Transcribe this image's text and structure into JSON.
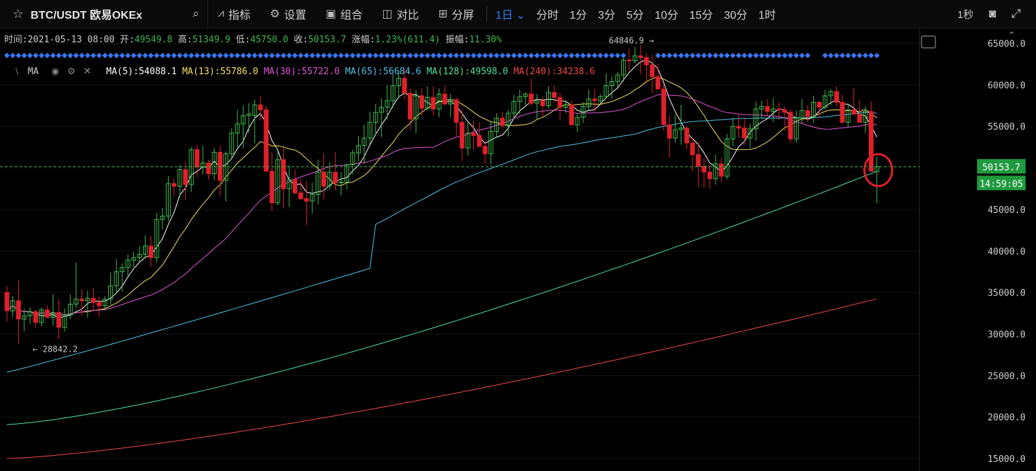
{
  "toolbar": {
    "symbol": "BTC/USDT 欧易OKEx",
    "indicators": "指标",
    "settings": "设置",
    "group": "组合",
    "compare": "对比",
    "split": "分屏",
    "intervals": [
      "1日",
      "分时",
      "1分",
      "3分",
      "5分",
      "10分",
      "15分",
      "30分",
      "1时"
    ],
    "active_interval": "1日",
    "refresh": "1秒"
  },
  "ohlc_bar": {
    "time_label": "时间:",
    "time": "2021-05-13 08:00",
    "open_label": "开:",
    "open": "49549.8",
    "high_label": "高:",
    "high": "51349.9",
    "low_label": "低:",
    "low": "45750.0",
    "close_label": "收:",
    "close": "50153.7",
    "change_label": "涨幅:",
    "change": "1.23%(611.4)",
    "amplitude_label": "振幅:",
    "amplitude": "11.30%"
  },
  "ma_bar": {
    "label": "MA",
    "items": [
      {
        "text": "MA(5):54088.1",
        "color": "#ffffff"
      },
      {
        "text": "MA(13):55786.0",
        "color": "#f5e15c"
      },
      {
        "text": "MA(30):55722.0",
        "color": "#e058d8"
      },
      {
        "text": "MA(65):56684.6",
        "color": "#4fc3e8"
      },
      {
        "text": "MA(128):49598.0",
        "color": "#4fe0a0"
      },
      {
        "text": "MA(240):34238.6",
        "color": "#f04848"
      }
    ]
  },
  "colors": {
    "up": "#3fb84f",
    "down": "#e0202a",
    "marker": "#3a78f2",
    "price_tag": "#1f9a3e"
  },
  "chart_data": {
    "type": "candlestick",
    "symbol": "BTC/USDT",
    "interval": "1日",
    "ylim": [
      13500,
      66800
    ],
    "yticks": [
      15000,
      20000,
      25000,
      30000,
      35000,
      40000,
      45000,
      50000,
      55000,
      60000,
      65000
    ],
    "ytick_labels": [
      "15000.0",
      "20000.0",
      "25000.0",
      "30000.0",
      "35000.0",
      "40000.0",
      "45000.0",
      "50000.0",
      "55000.0",
      "60000.0",
      "65000.0"
    ],
    "last_price": 50153.7,
    "last_price_label": "50153.7",
    "countdown": "14:59:05",
    "high_annotation": {
      "index": 112,
      "value": 64846.9,
      "label": "64846.9 →"
    },
    "low_annotation": {
      "index": 3,
      "value": 28842.2,
      "label": "← 28842.2"
    },
    "candles": [
      [
        35000,
        35800,
        31500,
        32800
      ],
      [
        32800,
        34600,
        32000,
        34000
      ],
      [
        34000,
        36500,
        28842.2,
        31800
      ],
      [
        31800,
        33000,
        30300,
        32200
      ],
      [
        32200,
        33200,
        31200,
        32700
      ],
      [
        32700,
        32900,
        30800,
        31400
      ],
      [
        31400,
        33200,
        30900,
        32900
      ],
      [
        32900,
        33500,
        31900,
        32000
      ],
      [
        32000,
        34800,
        31000,
        32600
      ],
      [
        32600,
        34200,
        29400,
        30800
      ],
      [
        30800,
        33100,
        30300,
        32300
      ],
      [
        32300,
        34800,
        31800,
        33600
      ],
      [
        33600,
        38600,
        33100,
        34200
      ],
      [
        34200,
        35400,
        32200,
        34000
      ],
      [
        34000,
        35200,
        32000,
        34300
      ],
      [
        34300,
        35500,
        32900,
        33800
      ],
      [
        33800,
        34500,
        32100,
        33400
      ],
      [
        33400,
        34600,
        32800,
        34200
      ],
      [
        34200,
        37400,
        33500,
        35800
      ],
      [
        35800,
        39000,
        34900,
        37500
      ],
      [
        37500,
        38500,
        35100,
        38000
      ],
      [
        38000,
        39600,
        37000,
        38900
      ],
      [
        38900,
        39900,
        38100,
        39200
      ],
      [
        39200,
        40600,
        38500,
        39600
      ],
      [
        39600,
        41900,
        39100,
        40600
      ],
      [
        40600,
        41800,
        38100,
        39200
      ],
      [
        39200,
        44600,
        38600,
        43800
      ],
      [
        43800,
        45200,
        42600,
        44200
      ],
      [
        44200,
        49000,
        43600,
        48100
      ],
      [
        48100,
        48700,
        46600,
        47800
      ],
      [
        47800,
        50400,
        46400,
        49800
      ],
      [
        49800,
        50800,
        46200,
        48000
      ],
      [
        48000,
        52500,
        47100,
        52200
      ],
      [
        52200,
        52800,
        48900,
        50100
      ],
      [
        50100,
        52700,
        49200,
        50600
      ],
      [
        50600,
        51000,
        48600,
        49300
      ],
      [
        49300,
        52400,
        48500,
        51900
      ],
      [
        51900,
        52700,
        46600,
        48500
      ],
      [
        48500,
        52000,
        46000,
        51700
      ],
      [
        51700,
        54800,
        51000,
        54200
      ],
      [
        54200,
        57000,
        52500,
        55300
      ],
      [
        55300,
        57500,
        52400,
        56300
      ],
      [
        56300,
        57800,
        54200,
        56500
      ],
      [
        56300,
        58200,
        53000,
        57600
      ],
      [
        57600,
        58600,
        55700,
        57000
      ],
      [
        57000,
        57500,
        51300,
        49600
      ],
      [
        49600,
        51900,
        44800,
        45800
      ],
      [
        45800,
        52200,
        45500,
        51000
      ],
      [
        51000,
        52500,
        45200,
        47500
      ],
      [
        47500,
        50300,
        45300,
        48600
      ],
      [
        48600,
        49800,
        46800,
        47000
      ],
      [
        47000,
        48600,
        46100,
        46300
      ],
      [
        46300,
        48400,
        43100,
        46000
      ],
      [
        46000,
        48200,
        44500,
        46800
      ],
      [
        46800,
        51000,
        45600,
        49500
      ],
      [
        49500,
        51800,
        46200,
        47800
      ],
      [
        47800,
        50700,
        47300,
        49500
      ],
      [
        49500,
        51900,
        47300,
        48200
      ],
      [
        48200,
        49500,
        46700,
        48300
      ],
      [
        48300,
        50500,
        47400,
        50400
      ],
      [
        50400,
        52200,
        49200,
        51800
      ],
      [
        51800,
        53800,
        50800,
        52700
      ],
      [
        52700,
        55200,
        50500,
        53600
      ],
      [
        53600,
        56800,
        52900,
        55500
      ],
      [
        55500,
        57700,
        54000,
        56700
      ],
      [
        56700,
        58400,
        53700,
        57300
      ],
      [
        57300,
        60000,
        55800,
        58100
      ],
      [
        58100,
        61300,
        57200,
        59900
      ],
      [
        59900,
        61700,
        58400,
        60800
      ],
      [
        60800,
        61900,
        58300,
        59000
      ],
      [
        59000,
        59600,
        54600,
        55900
      ],
      [
        55900,
        59400,
        54200,
        58700
      ],
      [
        58700,
        59600,
        56300,
        57200
      ],
      [
        57200,
        59800,
        56900,
        58500
      ],
      [
        58500,
        59800,
        56300,
        57100
      ],
      [
        57100,
        59600,
        56100,
        58900
      ],
      [
        58900,
        59900,
        57600,
        57700
      ],
      [
        57700,
        58900,
        56100,
        58200
      ],
      [
        58200,
        58500,
        53900,
        55500
      ],
      [
        55500,
        57000,
        50800,
        52400
      ],
      [
        52400,
        55600,
        51500,
        54200
      ],
      [
        54200,
        55700,
        52200,
        53900
      ],
      [
        53900,
        55500,
        52500,
        52600
      ],
      [
        52600,
        53200,
        50500,
        51700
      ],
      [
        51700,
        55600,
        50400,
        54400
      ],
      [
        54400,
        56600,
        53600,
        56000
      ],
      [
        56000,
        56800,
        54700,
        55100
      ],
      [
        55100,
        57000,
        53800,
        56600
      ],
      [
        56600,
        58800,
        55900,
        58000
      ],
      [
        58000,
        59400,
        56500,
        58600
      ],
      [
        58600,
        59100,
        57600,
        58900
      ],
      [
        58900,
        60700,
        57500,
        57800
      ],
      [
        57800,
        58900,
        55800,
        58100
      ],
      [
        58100,
        58600,
        56200,
        57500
      ],
      [
        57500,
        59800,
        57200,
        59100
      ],
      [
        59100,
        59900,
        57900,
        58500
      ],
      [
        58500,
        59000,
        55800,
        57300
      ],
      [
        57300,
        58200,
        56600,
        57600
      ],
      [
        57600,
        58100,
        55100,
        55200
      ],
      [
        55200,
        56600,
        54300,
        56100
      ],
      [
        56100,
        57900,
        55400,
        57400
      ],
      [
        57400,
        59400,
        57000,
        58300
      ],
      [
        58300,
        59500,
        56800,
        58100
      ],
      [
        58100,
        58900,
        57800,
        58600
      ],
      [
        58600,
        61400,
        58300,
        59900
      ],
      [
        59900,
        61000,
        58300,
        60400
      ],
      [
        60400,
        61600,
        59500,
        61200
      ],
      [
        61200,
        63500,
        60400,
        63000
      ],
      [
        63000,
        64400,
        61700,
        62900
      ],
      [
        62900,
        64600,
        62600,
        63500
      ],
      [
        63500,
        64846.9,
        61300,
        63300
      ],
      [
        63300,
        63800,
        60200,
        62400
      ],
      [
        62400,
        63600,
        59000,
        61000
      ],
      [
        61000,
        62500,
        59900,
        59500
      ],
      [
        59500,
        60100,
        54500,
        55200
      ],
      [
        55200,
        56300,
        51200,
        53600
      ],
      [
        53600,
        56400,
        53100,
        54600
      ],
      [
        54600,
        57600,
        52800,
        54800
      ],
      [
        54800,
        55100,
        52300,
        53000
      ],
      [
        53000,
        53700,
        49600,
        51600
      ],
      [
        51600,
        53000,
        47700,
        50200
      ],
      [
        50200,
        51200,
        47600,
        49500
      ],
      [
        49500,
        50300,
        47500,
        48700
      ],
      [
        48700,
        51600,
        48000,
        50500
      ],
      [
        50500,
        51200,
        48300,
        49000
      ],
      [
        49000,
        54100,
        48600,
        53500
      ],
      [
        53500,
        56000,
        52600,
        55000
      ],
      [
        55000,
        56500,
        53600,
        54800
      ],
      [
        54800,
        56000,
        52800,
        53600
      ],
      [
        53600,
        55300,
        52400,
        54700
      ],
      [
        54700,
        58000,
        53300,
        57100
      ],
      [
        57100,
        58100,
        55900,
        57400
      ],
      [
        57400,
        58300,
        56200,
        56800
      ],
      [
        56800,
        58400,
        55500,
        57100
      ],
      [
        57100,
        57900,
        55800,
        57000
      ],
      [
        57000,
        57400,
        54500,
        56700
      ],
      [
        56700,
        57100,
        53000,
        53500
      ],
      [
        53500,
        56900,
        53000,
        56000
      ],
      [
        56000,
        58300,
        55400,
        56900
      ],
      [
        56900,
        57600,
        55500,
        56200
      ],
      [
        56200,
        58700,
        55400,
        57900
      ],
      [
        57900,
        58100,
        56100,
        57300
      ],
      [
        57300,
        59400,
        57000,
        58700
      ],
      [
        58700,
        59500,
        57600,
        59200
      ],
      [
        59200,
        59800,
        57400,
        57900
      ],
      [
        57900,
        58800,
        55300,
        55500
      ],
      [
        55500,
        57800,
        54900,
        57000
      ],
      [
        57000,
        59600,
        56300,
        56500
      ],
      [
        56500,
        58200,
        55600,
        55500
      ],
      [
        55500,
        57400,
        54200,
        56800
      ],
      [
        56800,
        58000,
        53000,
        49600
      ],
      [
        49549.8,
        51349.9,
        45750,
        50153.7
      ]
    ]
  }
}
